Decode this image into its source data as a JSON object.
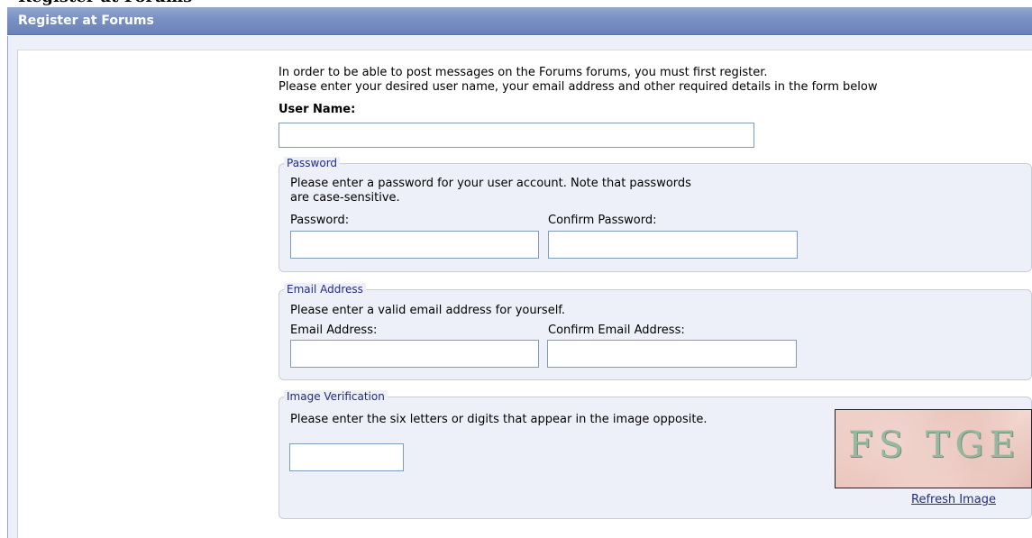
{
  "page_title": "Register at Forums",
  "intro": {
    "line1": "In order to be able to post messages on the Forums forums, you must first register.",
    "line2": "Please enter your desired user name, your email address and other required details in the form below"
  },
  "username": {
    "label": "User Name:",
    "value": ""
  },
  "password_section": {
    "legend": "Password",
    "description_line1": "Please enter a password for your user account. Note that passwords",
    "description_line2": "are case-sensitive.",
    "password_label": "Password:",
    "confirm_label": "Confirm Password:",
    "password_value": "",
    "confirm_value": ""
  },
  "email_section": {
    "legend": "Email Address",
    "description": "Please enter a valid email address for yourself.",
    "email_label": "Email Address:",
    "confirm_label": "Confirm Email Address:",
    "email_value": "",
    "confirm_value": ""
  },
  "verification_section": {
    "legend": "Image Verification",
    "description": "Please enter the six letters or digits that appear in the image opposite.",
    "code_value": "",
    "captcha_text": "FS TGE",
    "refresh_label": "Refresh Image"
  },
  "colors": {
    "header": "#7890c2",
    "panel": "#eef0f9",
    "legend": "#1f2d84",
    "input_border": "#7f9db9"
  }
}
